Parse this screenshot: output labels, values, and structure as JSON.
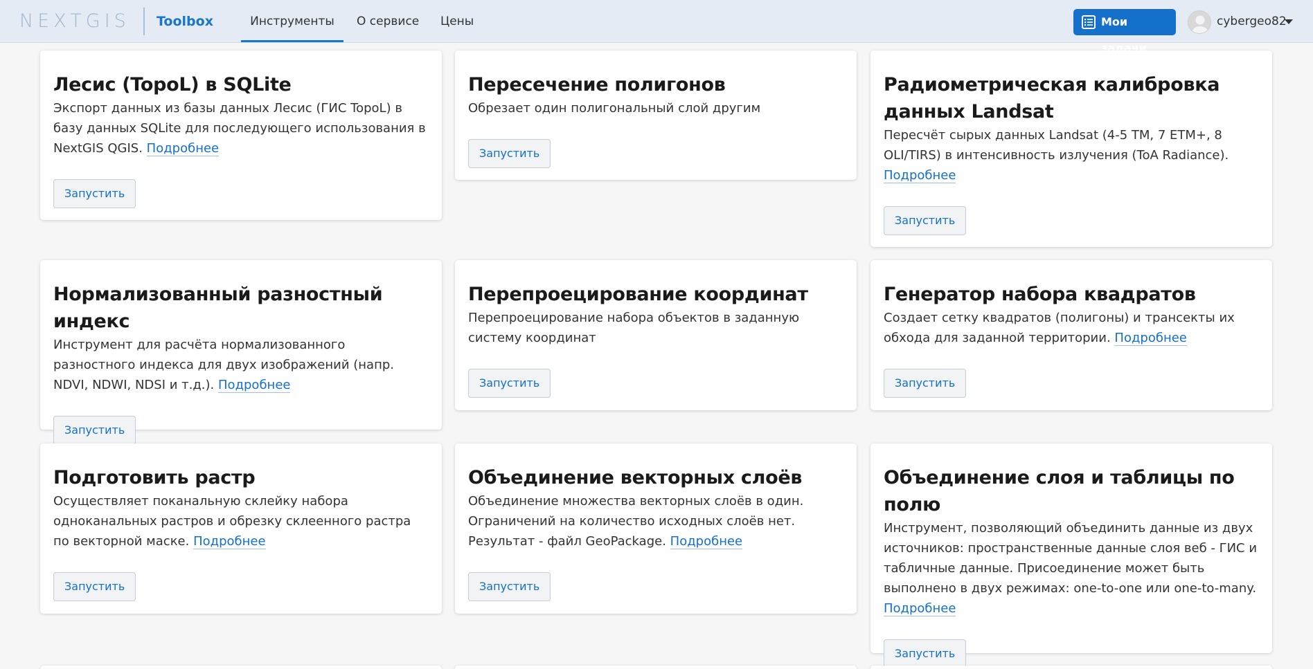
{
  "header": {
    "logo": "NEXTGIS",
    "product": "Toolbox",
    "nav": [
      "Инструменты",
      "О сервисе",
      "Цены"
    ],
    "tasks_button": "Мои задачи",
    "username": "cybergeo82"
  },
  "colors": {
    "accent": "#1470c9",
    "header_bg": "#e4ebf5",
    "page_bg": "#f6f6f6"
  },
  "cards": [
    {
      "title": "Лесис (TopoL) в SQLite",
      "desc": "Экспорт данных из базы данных Лесис (ГИС TopoL) в базу данных SQLite для последующего использования в NextGIS QGIS.",
      "link": "Подробнее",
      "button": "Запустить"
    },
    {
      "title": "Пересечение полигонов",
      "desc": "Обрезает один полигональный слой другим",
      "link": "",
      "button": "Запустить"
    },
    {
      "title": "Радиометрическая калибровка данных Landsat",
      "desc": "Пересчёт сырых данных Landsat (4-5 TM, 7 ETM+, 8 OLI/TIRS) в интенсивность излучения (ToA Radiance).",
      "link": "Подробнее",
      "button": "Запустить"
    },
    {
      "title": "Нормализованный разностный индекс",
      "desc": "Инструмент для расчёта нормализованного разностного индекса для двух изображений (напр. NDVI, NDWI, NDSI и т.д.).",
      "link": "Подробнее",
      "button": "Запустить"
    },
    {
      "title": "Перепроецирование координат",
      "desc": "Перепроецирование набора объектов в заданную систему координат",
      "link": "",
      "button": "Запустить"
    },
    {
      "title": "Генератор набора квадратов",
      "desc": "Создает сетку квадратов (полигоны) и трансекты их обхода для заданной территории.",
      "link": "Подробнее",
      "button": "Запустить"
    },
    {
      "title": "Подготовить растр",
      "desc": "Осуществляет поканальную склейку набора одноканальных растров и обрезку склеенного растра по векторной маске.",
      "link": "Подробнее",
      "button": "Запустить"
    },
    {
      "title": "Объединение векторных слоёв",
      "desc": "Объединение множества векторных слоёв в один. Ограничений на количество исходных слоёв нет. Результат - файл GeoPackage.",
      "link": "Подробнее",
      "button": "Запустить"
    },
    {
      "title": "Объединение слоя и таблицы по полю",
      "desc": "Инструмент, позволяющий объединить данные из двух источников: пространственные данные слоя веб - ГИС и табличные данные. Присоединение может быть выполнено в двух режимах: one-to-one или one-to-many.",
      "link": "Подробнее",
      "button": "Запустить"
    }
  ]
}
